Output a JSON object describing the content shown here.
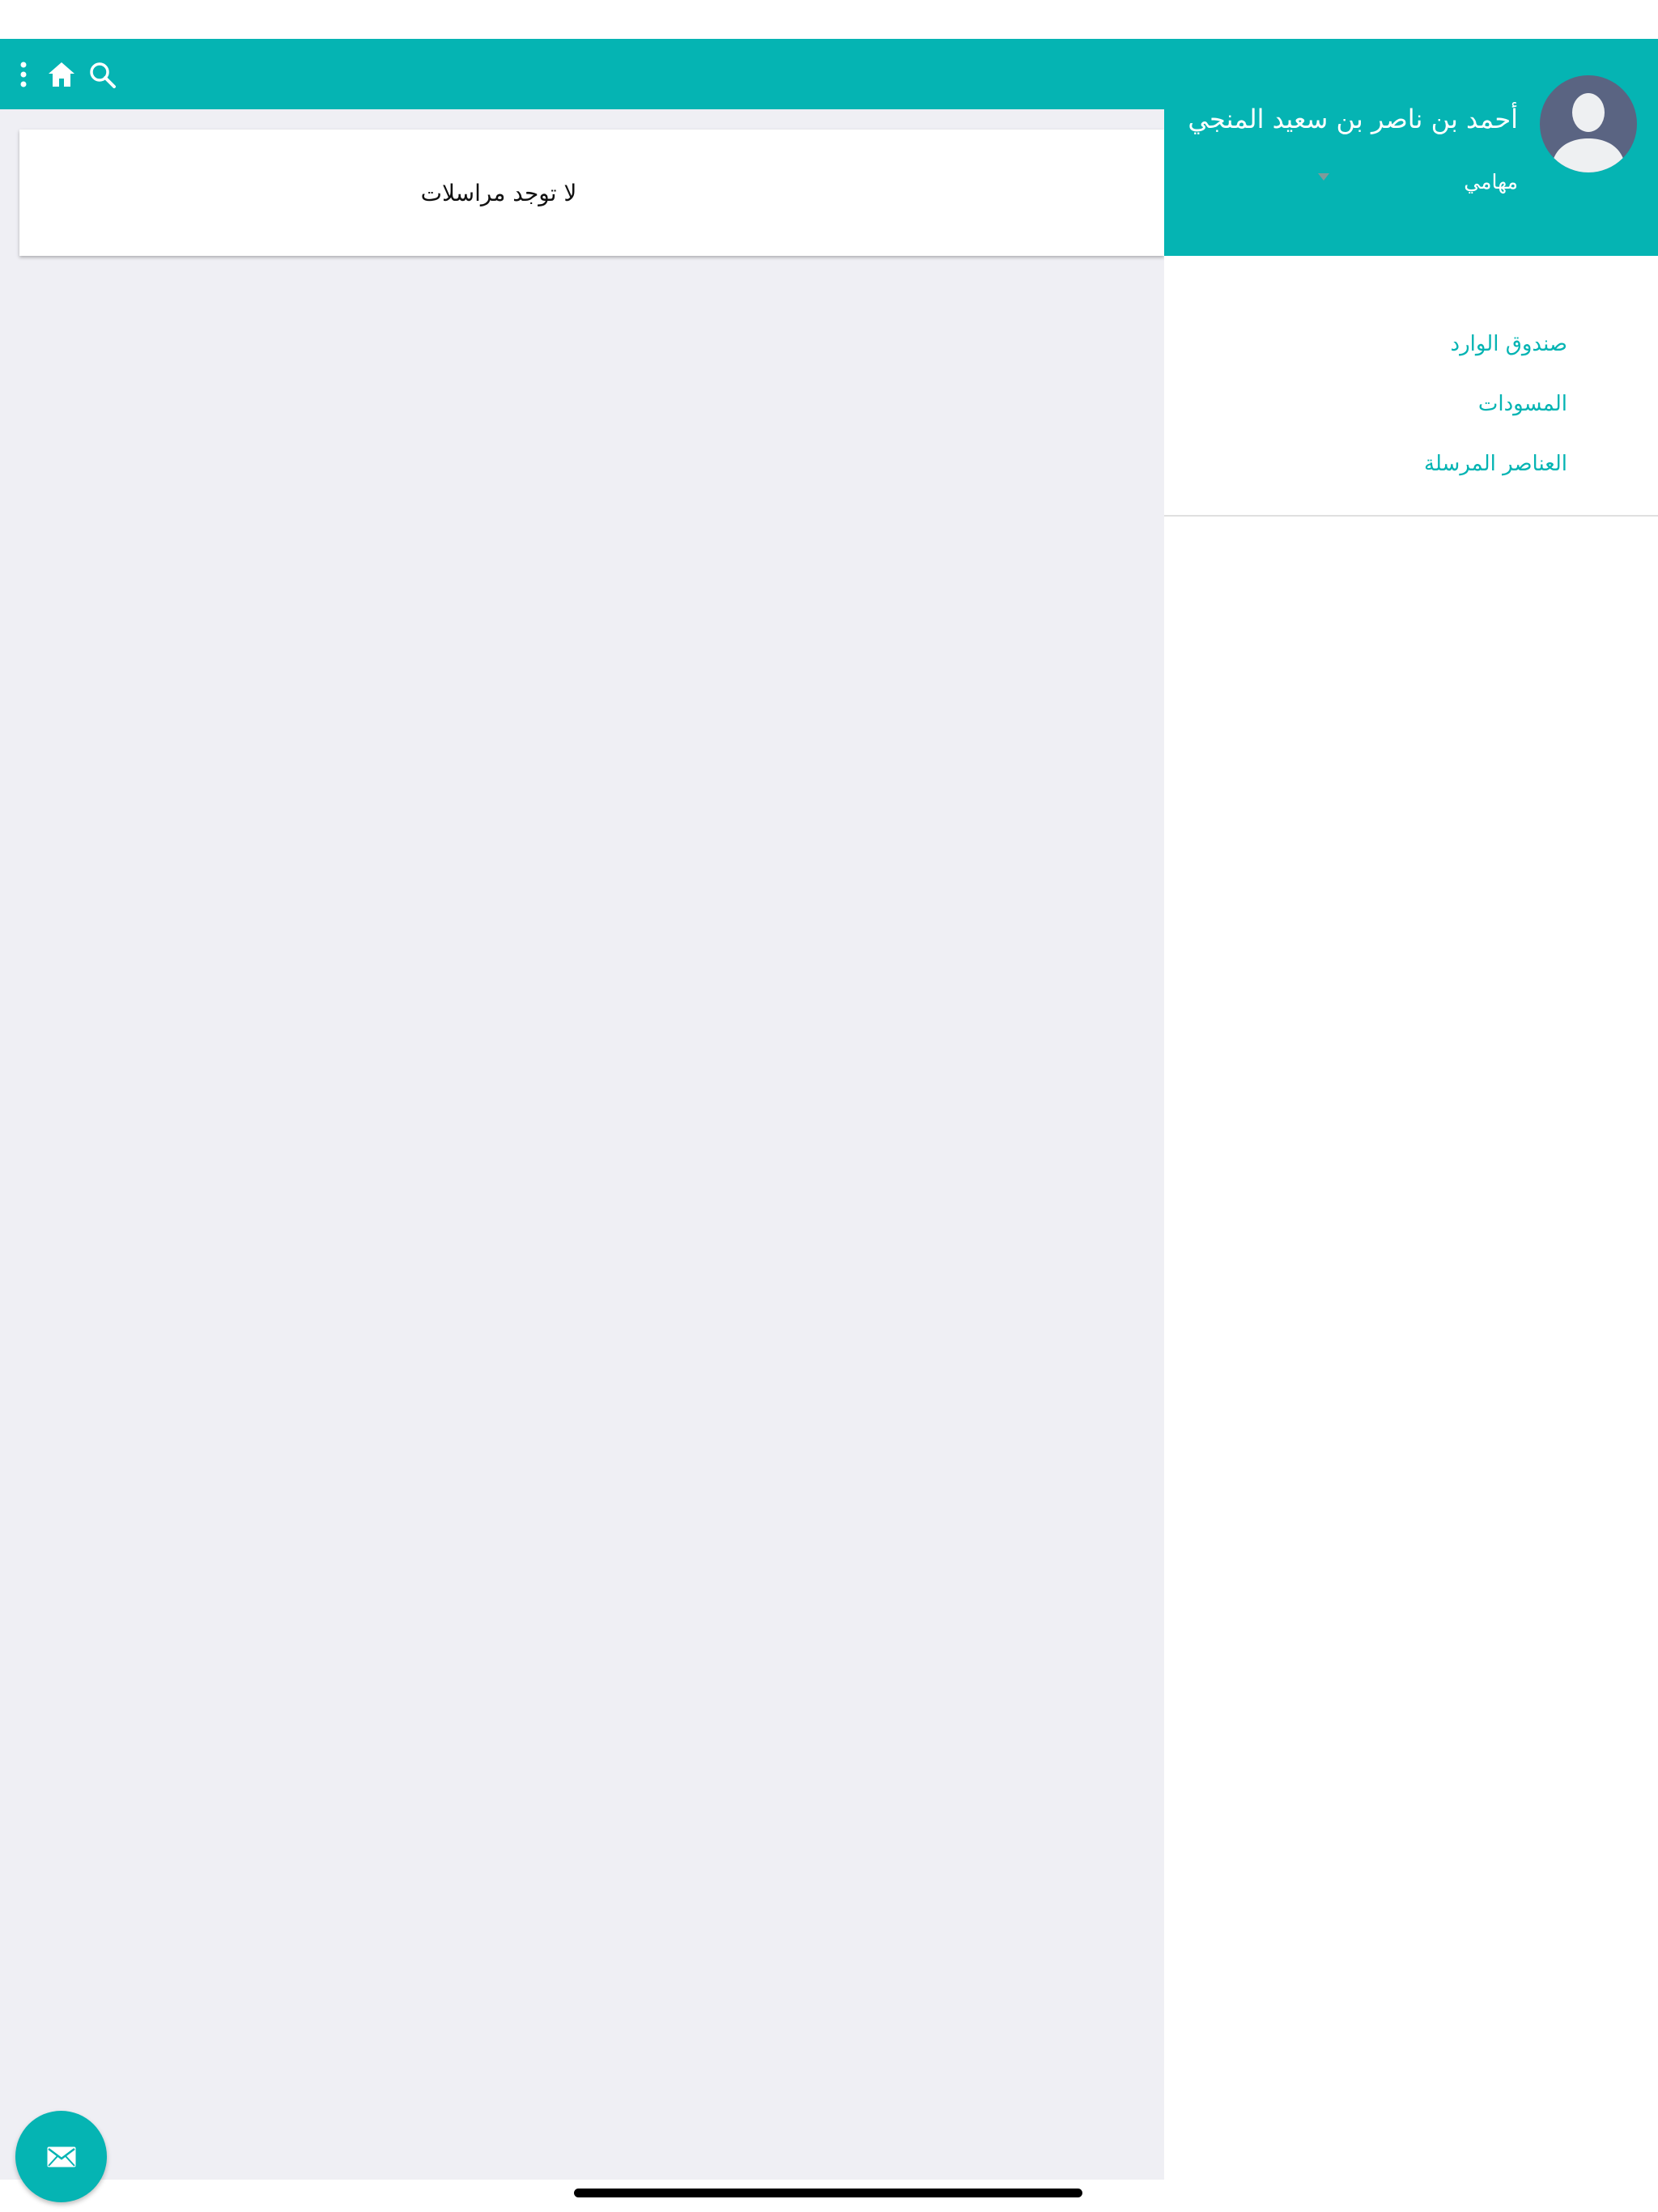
{
  "colors": {
    "accent": "#05b4b3",
    "background": "#efeff4",
    "drawer": "#ffffff",
    "avatar": "#5a6482"
  },
  "toolbar": {
    "icons": [
      "more-vertical-icon",
      "home-icon",
      "search-icon"
    ]
  },
  "main": {
    "empty_message": "لا توجد مراسلات"
  },
  "drawer": {
    "user_name": "أحمد بن ناصر بن سعيد المنجي",
    "user_section": "مهامي",
    "menu": [
      {
        "label": "صندوق الوارد"
      },
      {
        "label": "المسودات"
      },
      {
        "label": "العناصر المرسلة"
      }
    ]
  },
  "fab": {
    "icon": "mail-icon"
  }
}
